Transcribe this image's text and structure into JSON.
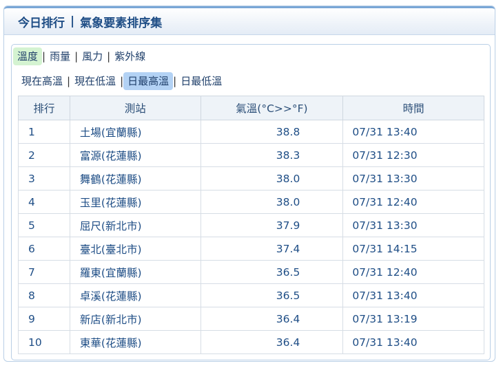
{
  "header": {
    "title_left": "今日排行",
    "separator": "|",
    "title_right": "氣象要素排序集"
  },
  "category_tabs": [
    {
      "label": "溫度",
      "active": true
    },
    {
      "label": "雨量",
      "active": false
    },
    {
      "label": "風力",
      "active": false
    },
    {
      "label": "紫外線",
      "active": false
    }
  ],
  "sub_tabs": [
    {
      "label": "現在高溫",
      "active": false
    },
    {
      "label": "現在低溫",
      "active": false
    },
    {
      "label": "日最高溫",
      "active": true
    },
    {
      "label": "日最低溫",
      "active": false
    }
  ],
  "table": {
    "columns": [
      "排行",
      "測站",
      "氣溫(°C>>°F)",
      "時間"
    ],
    "rows": [
      {
        "rank": "1",
        "station": "土場(宜蘭縣)",
        "temp": "38.8",
        "time": "07/31 13:40"
      },
      {
        "rank": "2",
        "station": "富源(花蓮縣)",
        "temp": "38.3",
        "time": "07/31 12:30"
      },
      {
        "rank": "3",
        "station": "舞鶴(花蓮縣)",
        "temp": "38.0",
        "time": "07/31 13:30"
      },
      {
        "rank": "4",
        "station": "玉里(花蓮縣)",
        "temp": "38.0",
        "time": "07/31 12:40"
      },
      {
        "rank": "5",
        "station": "屈尺(新北市)",
        "temp": "37.9",
        "time": "07/31 13:30"
      },
      {
        "rank": "6",
        "station": "臺北(臺北市)",
        "temp": "37.4",
        "time": "07/31 14:15"
      },
      {
        "rank": "7",
        "station": "羅東(宜蘭縣)",
        "temp": "36.5",
        "time": "07/31 12:40"
      },
      {
        "rank": "8",
        "station": "卓溪(花蓮縣)",
        "temp": "36.5",
        "time": "07/31 13:40"
      },
      {
        "rank": "9",
        "station": "新店(新北市)",
        "temp": "36.4",
        "time": "07/31 13:19"
      },
      {
        "rank": "10",
        "station": "東華(花蓮縣)",
        "temp": "36.4",
        "time": "07/31 13:40"
      }
    ]
  },
  "colors": {
    "text": "#1f4e86",
    "active_category_tab": "#d4f3d1",
    "active_sub_tab": "#b3d2f4",
    "header_accent": "#7aa7d6"
  }
}
